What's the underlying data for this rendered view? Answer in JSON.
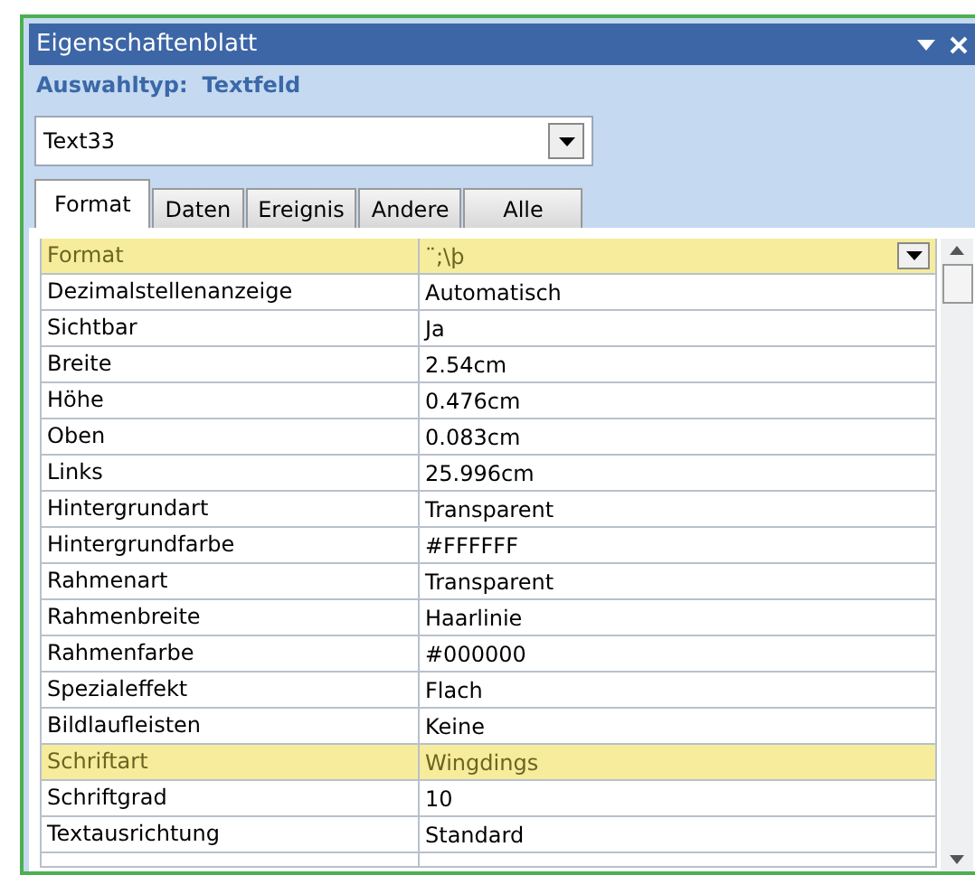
{
  "window": {
    "title": "Eigenschaftenblatt"
  },
  "selection_type": {
    "label": "Auswahltyp:",
    "value": "Textfeld"
  },
  "object_combo": {
    "value": "Text33"
  },
  "tabs": [
    {
      "label": "Format",
      "selected": true
    },
    {
      "label": "Daten",
      "selected": false
    },
    {
      "label": "Ereignis",
      "selected": false
    },
    {
      "label": "Andere",
      "selected": false
    },
    {
      "label": "Alle",
      "selected": false
    }
  ],
  "properties": [
    {
      "name": "Format",
      "value": "¨;\\þ",
      "highlighted": true,
      "dropdown": true
    },
    {
      "name": "Dezimalstellenanzeige",
      "value": "Automatisch",
      "highlighted": false,
      "dropdown": false
    },
    {
      "name": "Sichtbar",
      "value": "Ja",
      "highlighted": false,
      "dropdown": false
    },
    {
      "name": "Breite",
      "value": "2.54cm",
      "highlighted": false,
      "dropdown": false
    },
    {
      "name": "Höhe",
      "value": "0.476cm",
      "highlighted": false,
      "dropdown": false
    },
    {
      "name": "Oben",
      "value": "0.083cm",
      "highlighted": false,
      "dropdown": false
    },
    {
      "name": "Links",
      "value": "25.996cm",
      "highlighted": false,
      "dropdown": false
    },
    {
      "name": "Hintergrundart",
      "value": "Transparent",
      "highlighted": false,
      "dropdown": false
    },
    {
      "name": "Hintergrundfarbe",
      "value": "#FFFFFF",
      "highlighted": false,
      "dropdown": false
    },
    {
      "name": "Rahmenart",
      "value": "Transparent",
      "highlighted": false,
      "dropdown": false
    },
    {
      "name": "Rahmenbreite",
      "value": "Haarlinie",
      "highlighted": false,
      "dropdown": false
    },
    {
      "name": "Rahmenfarbe",
      "value": "#000000",
      "highlighted": false,
      "dropdown": false
    },
    {
      "name": "Spezialeffekt",
      "value": "Flach",
      "highlighted": false,
      "dropdown": false
    },
    {
      "name": "Bildlaufleisten",
      "value": "Keine",
      "highlighted": false,
      "dropdown": false
    },
    {
      "name": "Schriftart",
      "value": "Wingdings",
      "highlighted": true,
      "dropdown": false
    },
    {
      "name": "Schriftgrad",
      "value": "10",
      "highlighted": false,
      "dropdown": false
    },
    {
      "name": "Textausrichtung",
      "value": "Standard",
      "highlighted": false,
      "dropdown": false
    }
  ]
}
